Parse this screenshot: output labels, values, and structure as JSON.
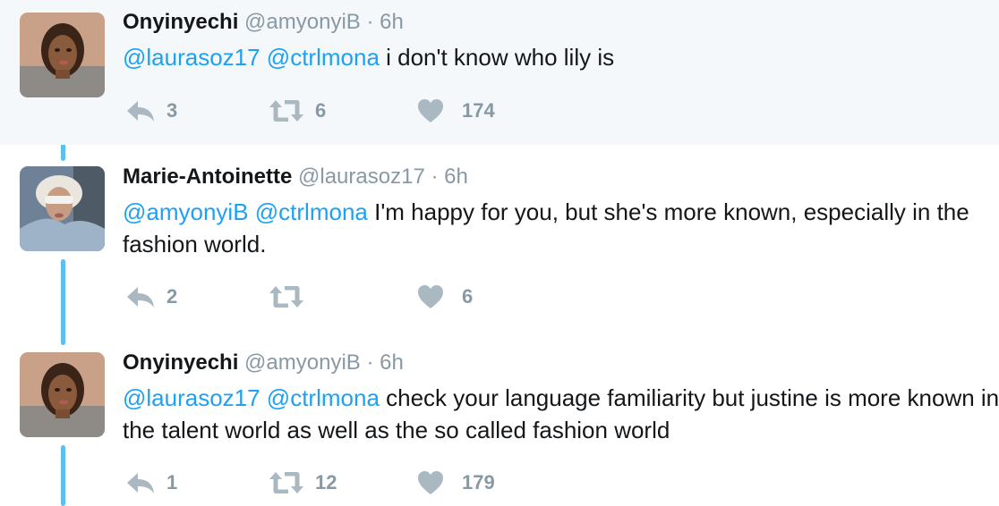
{
  "thread": {
    "tweets": [
      {
        "name": "Onyinyechi",
        "handle": "@amyonyiB",
        "separator": "·",
        "time": "6h",
        "mentions": "@laurasoz17 @ctrlmona",
        "text": "i don't know who lily is",
        "replies": "3",
        "retweets": "6",
        "likes": "174"
      },
      {
        "name": "Marie-Antoinette",
        "handle": "@laurasoz17",
        "separator": "·",
        "time": "6h",
        "mentions": "@amyonyiB @ctrlmona",
        "text": "I'm happy for you, but she's more known, especially in the fashion world.",
        "replies": "2",
        "retweets": "",
        "likes": "6"
      },
      {
        "name": "Onyinyechi",
        "handle": "@amyonyiB",
        "separator": "·",
        "time": "6h",
        "mentions": "@laurasoz17 @ctrlmona",
        "text": "check your language familiarity but justine is more known in the talent world as well as the so called fashion world",
        "replies": "1",
        "retweets": "12",
        "likes": "179"
      }
    ]
  },
  "icons": {
    "reply": "reply-icon",
    "retweet": "retweet-icon",
    "like": "heart-icon"
  },
  "colors": {
    "thread_line": "#5bc0eb",
    "mention": "#1da1f2",
    "meta": "#8899a6",
    "icon": "#aab8c2",
    "highlight_bg": "#f5f8fa"
  }
}
